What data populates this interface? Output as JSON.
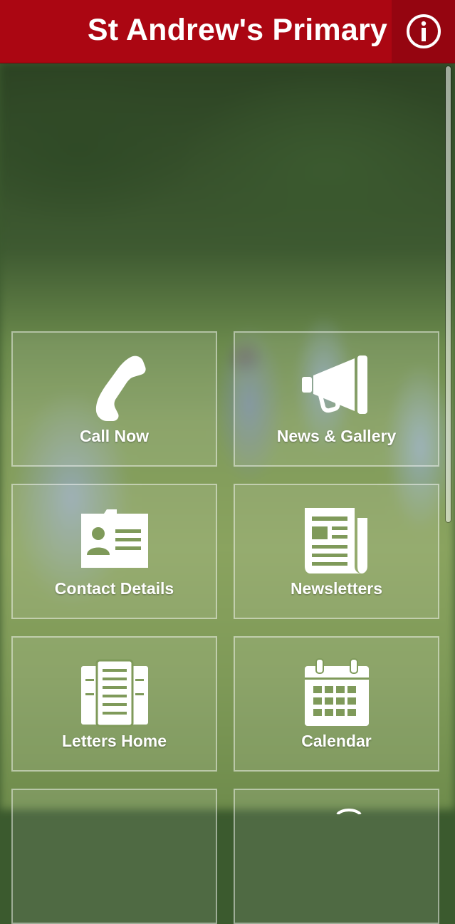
{
  "header": {
    "title": "St Andrew's Primary",
    "info_icon": "info-icon",
    "background": "#ab0612"
  },
  "tiles": [
    {
      "label": "Call Now",
      "icon": "phone-icon"
    },
    {
      "label": "News & Gallery",
      "icon": "megaphone-icon"
    },
    {
      "label": "Contact Details",
      "icon": "contact-card-icon"
    },
    {
      "label": "Newsletters",
      "icon": "newspaper-icon"
    },
    {
      "label": "Letters Home",
      "icon": "letters-icon"
    },
    {
      "label": "Calendar",
      "icon": "calendar-icon"
    }
  ]
}
